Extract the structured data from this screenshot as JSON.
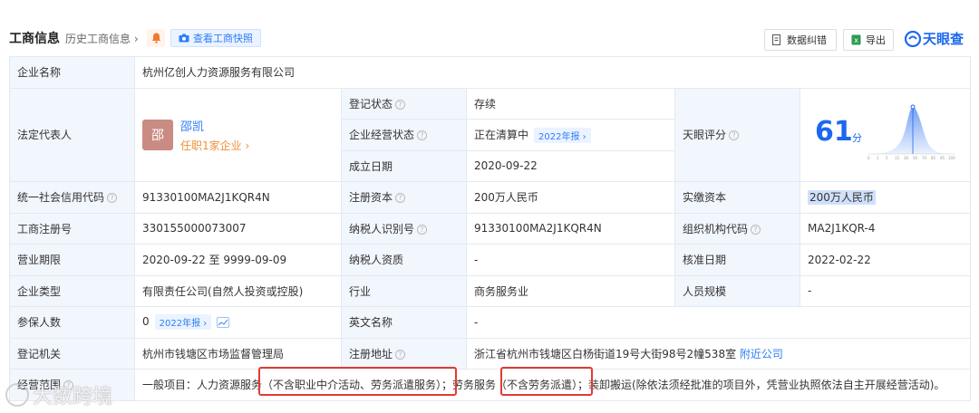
{
  "header": {
    "title": "工商信息",
    "history_label": "历史工商信息 ›",
    "snapshot_label": "查看工商快照",
    "correct_label": "数据纠错",
    "export_label": "导出",
    "logo_text": "天眼查"
  },
  "company": {
    "name_label": "企业名称",
    "name": "杭州亿创人力资源服务有限公司",
    "legal_label": "法定代表人",
    "legal_avatar": "邵",
    "legal_name": "邵凯",
    "legal_job": "任职1家企业 ›",
    "reg_status_label": "登记状态",
    "reg_status": "存续",
    "op_status_label": "企业经营状态",
    "op_status": "正在清算中",
    "op_status_tag": "2022年报 ›",
    "found_label": "成立日期",
    "found_date": "2020-09-22",
    "score_label": "天眼评分",
    "score": "61",
    "score_unit": "分",
    "credit_code_label": "统一社会信用代码",
    "credit_code": "91330100MA2J1KQR4N",
    "reg_capital_label": "注册资本",
    "reg_capital": "200万人民币",
    "paid_capital_label": "实缴资本",
    "paid_capital": "200万人民币",
    "reg_no_label": "工商注册号",
    "reg_no": "330155000073007",
    "taxpayer_id_label": "纳税人识别号",
    "taxpayer_id": "91330100MA2J1KQR4N",
    "org_code_label": "组织机构代码",
    "org_code": "MA2J1KQR-4",
    "term_label": "营业期限",
    "term": "2020-09-22 至 9999-09-09",
    "taxpayer_qual_label": "纳税人资质",
    "taxpayer_qual": "-",
    "approval_label": "核准日期",
    "approval_date": "2022-02-22",
    "type_label": "企业类型",
    "type": "有限责任公司(自然人投资或控股)",
    "industry_label": "行业",
    "industry": "商务服务业",
    "staff_label": "人员规模",
    "staff": "-",
    "insured_label": "参保人数",
    "insured": "0",
    "insured_tag": "2022年报 ›",
    "en_name_label": "英文名称",
    "en_name": "-",
    "authority_label": "登记机关",
    "authority": "杭州市钱塘区市场监督管理局",
    "address_label": "注册地址",
    "address": "浙江省杭州市钱塘区白杨街道19号大街98号2幢538室",
    "nearby_label": "附近公司",
    "scope_label": "经营范围",
    "scope": "一般项目：人力资源服务（不含职业中介活动、劳务派遣服务）；劳务服务（不含劳务派遣）；装卸搬运(除依法须经批准的项目外，凭营业执照依法自主开展经营活动)。"
  },
  "watermark": "大数跨境",
  "colors": {
    "accent": "#2f7ef7",
    "status_green": "#3aa55e",
    "highlight_box": "#e23b33"
  }
}
